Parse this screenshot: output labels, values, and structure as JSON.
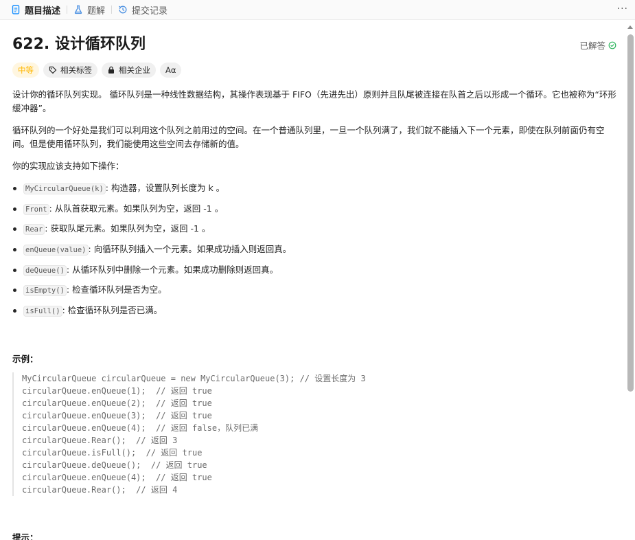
{
  "tabs": [
    {
      "label": "题目描述",
      "icon": "document-icon",
      "active": true
    },
    {
      "label": "题解",
      "icon": "flask-icon",
      "active": false
    },
    {
      "label": "提交记录",
      "icon": "history-icon",
      "active": false
    }
  ],
  "more_label": "···",
  "problem": {
    "title": "622. 设计循环队列",
    "status": "已解答",
    "status_color": "#2db55d"
  },
  "tags": [
    {
      "label": "中等",
      "icon": "",
      "color": "#ffb700"
    },
    {
      "label": "相关标签",
      "icon": "tag-icon"
    },
    {
      "label": "相关企业",
      "icon": "lock-icon"
    },
    {
      "label": "Aα",
      "icon": "font-icon"
    }
  ],
  "description": {
    "p1": "设计你的循环队列实现。 循环队列是一种线性数据结构，其操作表现基于 FIFO（先进先出）原则并且队尾被连接在队首之后以形成一个循环。它也被称为“环形缓冲器”。",
    "p2": "循环队列的一个好处是我们可以利用这个队列之前用过的空间。在一个普通队列里，一旦一个队列满了，我们就不能插入下一个元素，即使在队列前面仍有空间。但是使用循环队列，我们能使用这些空间去存储新的值。",
    "p3": "你的实现应该支持如下操作："
  },
  "operations": [
    {
      "code": "MyCircularQueue(k)",
      "text": ": 构造器，设置队列长度为 k 。"
    },
    {
      "code": "Front",
      "text": ": 从队首获取元素。如果队列为空，返回 -1 。"
    },
    {
      "code": "Rear",
      "text": ": 获取队尾元素。如果队列为空，返回 -1 。"
    },
    {
      "code": "enQueue(value)",
      "text": ": 向循环队列插入一个元素。如果成功插入则返回真。"
    },
    {
      "code": "deQueue()",
      "text": ": 从循环队列中删除一个元素。如果成功删除则返回真。"
    },
    {
      "code": "isEmpty()",
      "text": ": 检查循环队列是否为空。"
    },
    {
      "code": "isFull()",
      "text": ": 检查循环队列是否已满。"
    }
  ],
  "example_title": "示例：",
  "example_lines": [
    "MyCircularQueue circularQueue = new MyCircularQueue(3); // 设置长度为 3",
    "circularQueue.enQueue(1);  // 返回 true",
    "circularQueue.enQueue(2);  // 返回 true",
    "circularQueue.enQueue(3);  // 返回 true",
    "circularQueue.enQueue(4);  // 返回 false，队列已满",
    "circularQueue.Rear();  // 返回 3",
    "circularQueue.isFull();  // 返回 true",
    "circularQueue.deQueue();  // 返回 true",
    "circularQueue.enQueue(4);  // 返回 true",
    "circularQueue.Rear();  // 返回 4"
  ],
  "hint_title": "提示："
}
